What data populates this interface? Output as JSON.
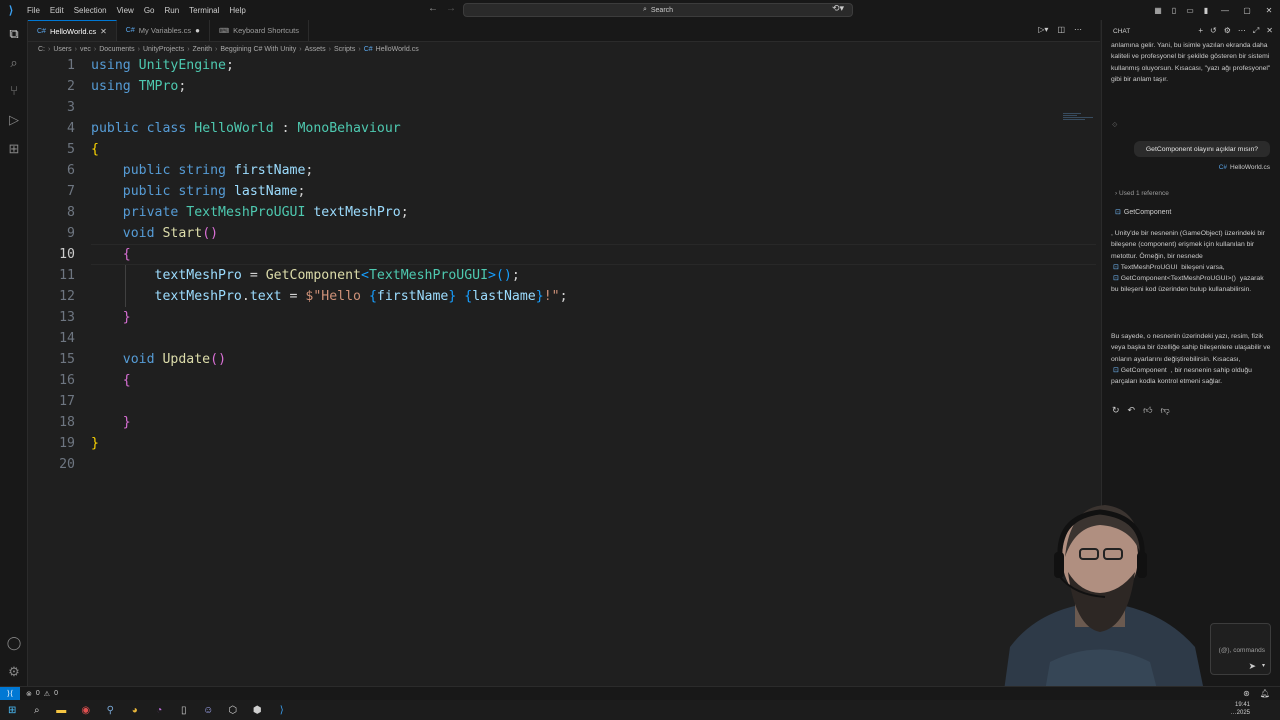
{
  "menu": [
    "File",
    "Edit",
    "Selection",
    "View",
    "Go",
    "Run",
    "Terminal",
    "Help"
  ],
  "search": {
    "placeholder": "Search"
  },
  "tabs": [
    {
      "label": "HelloWorld.cs",
      "active": true,
      "icon": "csharp-icon",
      "state": "close"
    },
    {
      "label": "My Variables.cs",
      "active": false,
      "icon": "csharp-icon",
      "state": "modified"
    },
    {
      "label": "Keyboard Shortcuts",
      "active": false,
      "icon": "keyboard-icon",
      "state": "none"
    }
  ],
  "breadcrumb": [
    "C:",
    "Users",
    "vec",
    "Documents",
    "UnityProjects",
    "Zenith",
    "Beggining C# With Unity",
    "Assets",
    "Scripts",
    "HelloWorld.cs"
  ],
  "editor": {
    "current_line": 10,
    "lines": [
      {
        "n": "1"
      },
      {
        "n": "2"
      },
      {
        "n": "3"
      },
      {
        "n": "4"
      },
      {
        "n": "5"
      },
      {
        "n": "6"
      },
      {
        "n": "7"
      },
      {
        "n": "8"
      },
      {
        "n": "9"
      },
      {
        "n": "10"
      },
      {
        "n": "11"
      },
      {
        "n": "12"
      },
      {
        "n": "13"
      },
      {
        "n": "14"
      },
      {
        "n": "15"
      },
      {
        "n": "16"
      },
      {
        "n": "17"
      },
      {
        "n": "18"
      },
      {
        "n": "19"
      },
      {
        "n": "20"
      }
    ],
    "code": [
      [
        [
          "kw",
          "using"
        ],
        [
          "pl",
          " "
        ],
        [
          "ty",
          "UnityEngine"
        ],
        [
          "pl",
          ";"
        ]
      ],
      [
        [
          "kw",
          "using"
        ],
        [
          "pl",
          " "
        ],
        [
          "ty",
          "TMPro"
        ],
        [
          "pl",
          ";"
        ]
      ],
      [],
      [
        [
          "kw",
          "public"
        ],
        [
          "pl",
          " "
        ],
        [
          "kw",
          "class"
        ],
        [
          "pl",
          " "
        ],
        [
          "ty",
          "HelloWorld"
        ],
        [
          "pl",
          " : "
        ],
        [
          "ty",
          "MonoBehaviour"
        ]
      ],
      [
        [
          "b1",
          "{"
        ]
      ],
      [
        [
          "pl",
          "    "
        ],
        [
          "kw",
          "public"
        ],
        [
          "pl",
          " "
        ],
        [
          "kw",
          "string"
        ],
        [
          "pl",
          " "
        ],
        [
          "id",
          "firstName"
        ],
        [
          "pl",
          ";"
        ]
      ],
      [
        [
          "pl",
          "    "
        ],
        [
          "kw",
          "public"
        ],
        [
          "pl",
          " "
        ],
        [
          "kw",
          "string"
        ],
        [
          "pl",
          " "
        ],
        [
          "id",
          "lastName"
        ],
        [
          "pl",
          ";"
        ]
      ],
      [
        [
          "pl",
          "    "
        ],
        [
          "kw",
          "private"
        ],
        [
          "pl",
          " "
        ],
        [
          "ty",
          "TextMeshProUGUI"
        ],
        [
          "pl",
          " "
        ],
        [
          "id",
          "textMeshPro"
        ],
        [
          "pl",
          ";"
        ]
      ],
      [
        [
          "pl",
          "    "
        ],
        [
          "kw",
          "void"
        ],
        [
          "pl",
          " "
        ],
        [
          "fn",
          "Start"
        ],
        [
          "b2",
          "()"
        ]
      ],
      [
        [
          "pl",
          "    "
        ],
        [
          "b2",
          "{"
        ]
      ],
      [
        [
          "pl",
          "        "
        ],
        [
          "id",
          "textMeshPro"
        ],
        [
          "pl",
          " = "
        ],
        [
          "fn",
          "GetComponent"
        ],
        [
          "b3",
          "<"
        ],
        [
          "ty",
          "TextMeshProUGUI"
        ],
        [
          "b3",
          ">"
        ],
        [
          "b3",
          "()"
        ],
        [
          "pl",
          ";"
        ]
      ],
      [
        [
          "pl",
          "        "
        ],
        [
          "id",
          "textMeshPro"
        ],
        [
          "pl",
          "."
        ],
        [
          "id",
          "text"
        ],
        [
          "pl",
          " = "
        ],
        [
          "str",
          "$\"Hello "
        ],
        [
          "b3",
          "{"
        ],
        [
          "id",
          "firstName"
        ],
        [
          "b3",
          "}"
        ],
        [
          "str",
          " "
        ],
        [
          "b3",
          "{"
        ],
        [
          "id",
          "lastName"
        ],
        [
          "b3",
          "}"
        ],
        [
          "str",
          "!\""
        ],
        [
          "pl",
          ";"
        ]
      ],
      [
        [
          "pl",
          "    "
        ],
        [
          "b2",
          "}"
        ]
      ],
      [],
      [
        [
          "pl",
          "    "
        ],
        [
          "kw",
          "void"
        ],
        [
          "pl",
          " "
        ],
        [
          "fn",
          "Update"
        ],
        [
          "b2",
          "()"
        ]
      ],
      [
        [
          "pl",
          "    "
        ],
        [
          "b2",
          "{"
        ]
      ],
      [],
      [
        [
          "pl",
          "    "
        ],
        [
          "b2",
          "}"
        ]
      ],
      [
        [
          "b1",
          "}"
        ]
      ],
      []
    ]
  },
  "chat": {
    "header": "CHAT",
    "intro_text": "anlamına gelir. Yani, bu isimle yazılan ekranda daha kaliteli ve profesyonel bir şekilde gösteren bir sistemi kullanmış oluyorsun. Kısacası, \"yazı ağı profesyonel\" gibi bir anlam taşır.",
    "user_question": "GetComponent olayını açıklar mısın?",
    "attached_file": "HelloWorld.cs",
    "used_references": "Used 1 reference",
    "reference_item": "GetComponent",
    "answer_p1_a": ", Unity'de bir nesnenin (GameObject) üzerindeki bir bileşene (component) erişmek için kullanılan bir metottur. Örneğin, bir nesnede",
    "answer_p1_ref": "TextMeshProUGUI",
    "answer_p1_b": "bileşeni varsa,",
    "answer_p1_ref2": "GetComponent<TextMeshProUGUI>()",
    "answer_p1_c": "yazarak bu bileşeni kod üzerinden bulup kullanabilirsin.",
    "answer_p2_a": "Bu sayede, o nesnenin üzerindeki yazı, resim, fizik veya başka bir özelliğe sahip bileşenlere ulaşabilir ve onların ayarlarını değiştirebilirsin. Kısacası,",
    "answer_p2_ref": "GetComponent",
    "answer_p2_b": ", bir nesnenin sahip olduğu parçaları kodla kontrol etmeni sağlar.",
    "input_placeholder": "(@), commands"
  },
  "status": {
    "errors": "0",
    "warnings": "0"
  },
  "clock": {
    "time": "19:41",
    "date": "…2025"
  },
  "colors": {
    "accent": "#0078d4",
    "background": "#1f1f1f",
    "panel": "#181818"
  }
}
